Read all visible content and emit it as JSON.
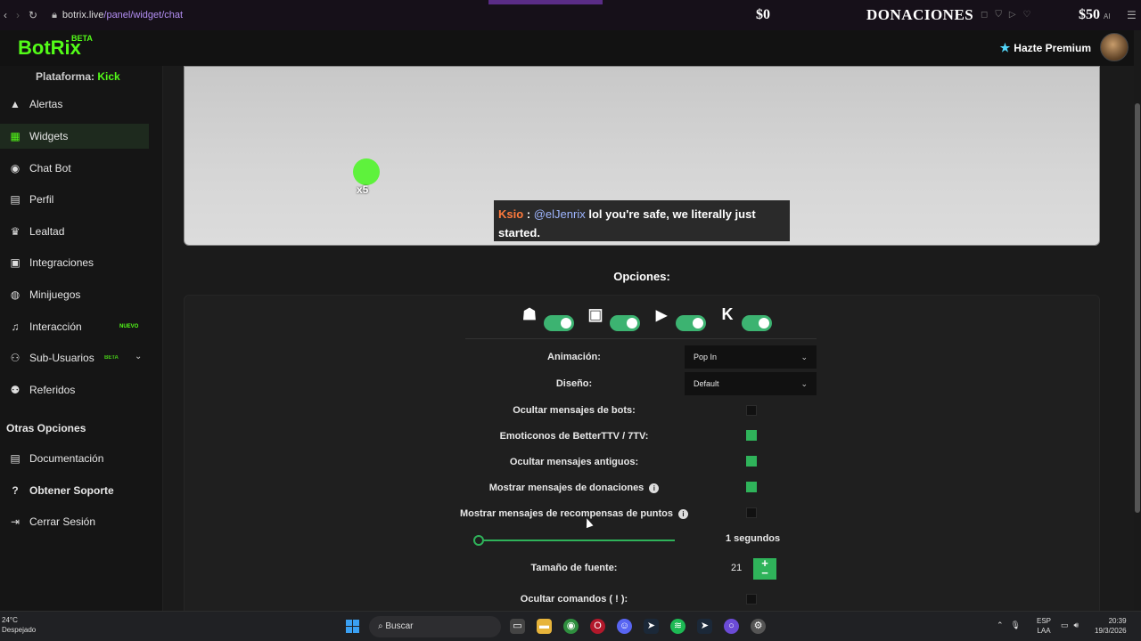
{
  "browser": {
    "url_host": "botrix.live",
    "url_path": "/panel/widget/chat",
    "donations_left": "$0",
    "donations_title": "DONACIONES",
    "donations_right": "$50",
    "donations_right_suffix": "AI"
  },
  "header": {
    "logo": "BotRix",
    "logo_badge": "BETA",
    "premium_label": "Hazte Premium"
  },
  "sidebar": {
    "platform_label": "Plataforma:",
    "platform_value": "Kick",
    "items": [
      {
        "label": "Alertas",
        "icon": "warning-icon"
      },
      {
        "label": "Widgets",
        "icon": "widgets-grid-icon"
      },
      {
        "label": "Chat Bot",
        "icon": "robot-icon"
      },
      {
        "label": "Perfil",
        "icon": "id-card-icon"
      },
      {
        "label": "Lealtad",
        "icon": "trophy-icon"
      },
      {
        "label": "Integraciones",
        "icon": "integrations-icon"
      },
      {
        "label": "Minijuegos",
        "icon": "gamepad-icon"
      },
      {
        "label": "Interacción",
        "icon": "music-note-icon",
        "badge": "NUEVO"
      },
      {
        "label": "Sub-Usuarios",
        "icon": "users-icon",
        "badge": "BETA"
      },
      {
        "label": "Referidos",
        "icon": "referrals-icon"
      }
    ],
    "section_title": "Otras Opciones",
    "other_items": [
      {
        "label": "Documentación",
        "icon": "docs-icon"
      },
      {
        "label": "Obtener Soporte",
        "icon": "help-icon"
      },
      {
        "label": "Cerrar Sesión",
        "icon": "logout-icon"
      }
    ]
  },
  "preview": {
    "emote_count": "x5",
    "chat_user": "Ksio",
    "chat_separator": " : ",
    "chat_mention": "@elJenrix",
    "chat_text": " lol you're safe, we literally just started."
  },
  "options": {
    "title": "Opciones:",
    "platform_icons": [
      "kick-bot-icon",
      "twitch-icon",
      "youtube-icon",
      "kick-icon"
    ],
    "animation_label": "Animación:",
    "animation_value": "Pop In",
    "design_label": "Diseño:",
    "design_value": "Default",
    "hide_bots_label": "Ocultar mensajes de bots:",
    "hide_bots": false,
    "bttv_label": "Emoticonos de BetterTTV / 7TV:",
    "bttv": true,
    "hide_old_label": "Ocultar mensajes antiguos:",
    "hide_old": true,
    "donations_label": "Mostrar mensajes de donaciones",
    "donations": true,
    "rewards_label": "Mostrar mensajes de recompensas de puntos",
    "rewards": false,
    "slider_value": "1 segundos",
    "slider_fraction": 0.0,
    "font_size_label": "Tamaño de fuente:",
    "font_size": "21",
    "hide_commands_label": "Ocultar comandos ( ! ):",
    "hide_commands": false
  },
  "taskbar": {
    "weather_temp": "24°C",
    "weather_desc": "Despejado",
    "search_label": "Buscar",
    "lang_1": "ESP",
    "lang_2": "LAA",
    "time": "20:39",
    "date": "19/3/2026"
  },
  "colors": {
    "brand_green": "#53fc18",
    "toggle_green": "#3cb371",
    "checkbox_green": "#2fb35a"
  }
}
